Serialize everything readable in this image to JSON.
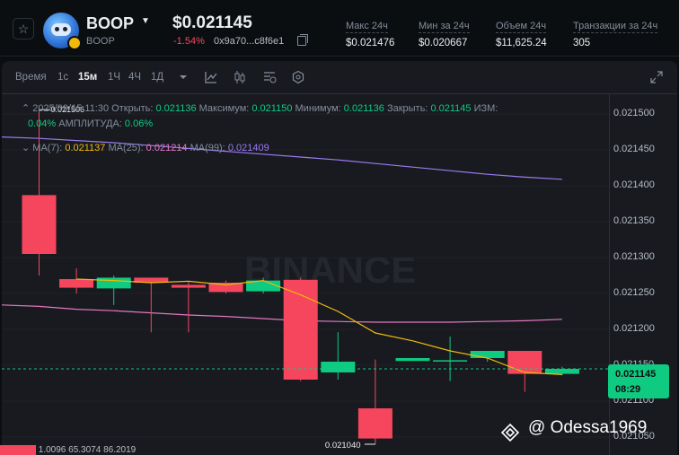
{
  "header": {
    "symbol": "BOOP",
    "symbol_sub": "BOOP",
    "price": "$0.021145",
    "change_pct": "-1.54%",
    "contract": "0x9a70...c8f6e1",
    "stats": [
      {
        "label": "Макс 24ч",
        "value": "$0.021476"
      },
      {
        "label": "Мин за 24ч",
        "value": "$0.020667"
      },
      {
        "label": "Объем 24ч",
        "value": "$11,625.24"
      },
      {
        "label": "Транзакции за 24ч",
        "value": "305"
      }
    ]
  },
  "toolbar": {
    "time_label": "Время",
    "intervals": [
      "1с",
      "15м",
      "1Ч",
      "4Ч",
      "1Д"
    ],
    "active_interval": "15м",
    "icons": [
      "dropdown-caret-icon",
      "line-tool-icon",
      "candle-type-icon",
      "indicators-icon",
      "settings-icon",
      "expand-icon"
    ]
  },
  "info_line": {
    "datetime": "2025/09/15 11:30",
    "open_label": "Открыть:",
    "open": "0.021136",
    "high_label": "Максимум:",
    "high": "0.021150",
    "low_label": "Минимум:",
    "low": "0.021136",
    "close_label": "Закрыть:",
    "close": "0.021145",
    "change_label": "ИЗМ:",
    "change": "0.04%",
    "amp_label": "АМПЛИТУДА:",
    "amp": "0.06%"
  },
  "ma_line": {
    "ma7_label": "MA(7):",
    "ma7": "0.021137",
    "ma25_label": "MA(25):",
    "ma25": "0.021214",
    "ma99_label": "MA(99):",
    "ma99": "0.021409"
  },
  "colors": {
    "up": "#0ecb81",
    "down": "#f6465d",
    "ma7": "#f0b90b",
    "ma25": "#e377c2",
    "ma99": "#9b7bf0"
  },
  "chart_data": {
    "type": "candlestick",
    "ytick_labels": [
      "0.021500",
      "0.021450",
      "0.021400",
      "0.021350",
      "0.021300",
      "0.021250",
      "0.021200",
      "0.021150",
      "0.021100",
      "0.021050"
    ],
    "ylim": [
      0.021025,
      0.021525
    ],
    "candles": [
      {
        "o": 0.021387,
        "h": 0.021506,
        "l": 0.021275,
        "c": 0.021305
      },
      {
        "o": 0.02127,
        "h": 0.021285,
        "l": 0.02125,
        "c": 0.021258
      },
      {
        "o": 0.021257,
        "h": 0.021275,
        "l": 0.021234,
        "c": 0.021272
      },
      {
        "o": 0.021272,
        "h": 0.021272,
        "l": 0.021196,
        "c": 0.021265
      },
      {
        "o": 0.021262,
        "h": 0.021266,
        "l": 0.021196,
        "c": 0.021258
      },
      {
        "o": 0.021265,
        "h": 0.021268,
        "l": 0.02125,
        "c": 0.021252
      },
      {
        "o": 0.021253,
        "h": 0.021272,
        "l": 0.02125,
        "c": 0.021268
      },
      {
        "o": 0.021269,
        "h": 0.021272,
        "l": 0.021128,
        "c": 0.02113
      },
      {
        "o": 0.02114,
        "h": 0.021196,
        "l": 0.02113,
        "c": 0.021155
      },
      {
        "o": 0.02109,
        "h": 0.021158,
        "l": 0.02104,
        "c": 0.021048
      },
      {
        "o": 0.021156,
        "h": 0.02116,
        "l": 0.021156,
        "c": 0.02116
      },
      {
        "o": 0.021157,
        "h": 0.02119,
        "l": 0.021128,
        "c": 0.021157
      },
      {
        "o": 0.02116,
        "h": 0.021168,
        "l": 0.021155,
        "c": 0.02117
      },
      {
        "o": 0.02117,
        "h": 0.02117,
        "l": 0.021113,
        "c": 0.021138
      },
      {
        "o": 0.021138,
        "h": 0.021148,
        "l": 0.021136,
        "c": 0.021145
      }
    ],
    "ma7": [
      null,
      0.02127,
      0.021268,
      0.021265,
      0.021267,
      0.021262,
      0.021268,
      0.021248,
      0.021225,
      0.021195,
      0.021184,
      0.02117,
      0.02116,
      0.02114,
      0.021137
    ],
    "ma25": [
      0.021232,
      0.021228,
      0.021226,
      0.021223,
      0.02122,
      0.021218,
      0.021215,
      0.021212,
      0.021211,
      0.02121,
      0.02121,
      0.02121,
      0.021211,
      0.021212,
      0.021214
    ],
    "ma99": [
      0.021466,
      0.021463,
      0.02146,
      0.021456,
      0.021452,
      0.021448,
      0.021444,
      0.02144,
      0.021436,
      0.021431,
      0.021426,
      0.021421,
      0.021416,
      0.021412,
      0.021409
    ],
    "high_marker": "0.021506",
    "low_marker": "0.021040",
    "current_price": "0.021145",
    "countdown": "08:29"
  },
  "watermark": "BINANCE",
  "footer_tag": "@ Odessa1969",
  "volume_strip": "1.0096   65.3074   86.2019"
}
